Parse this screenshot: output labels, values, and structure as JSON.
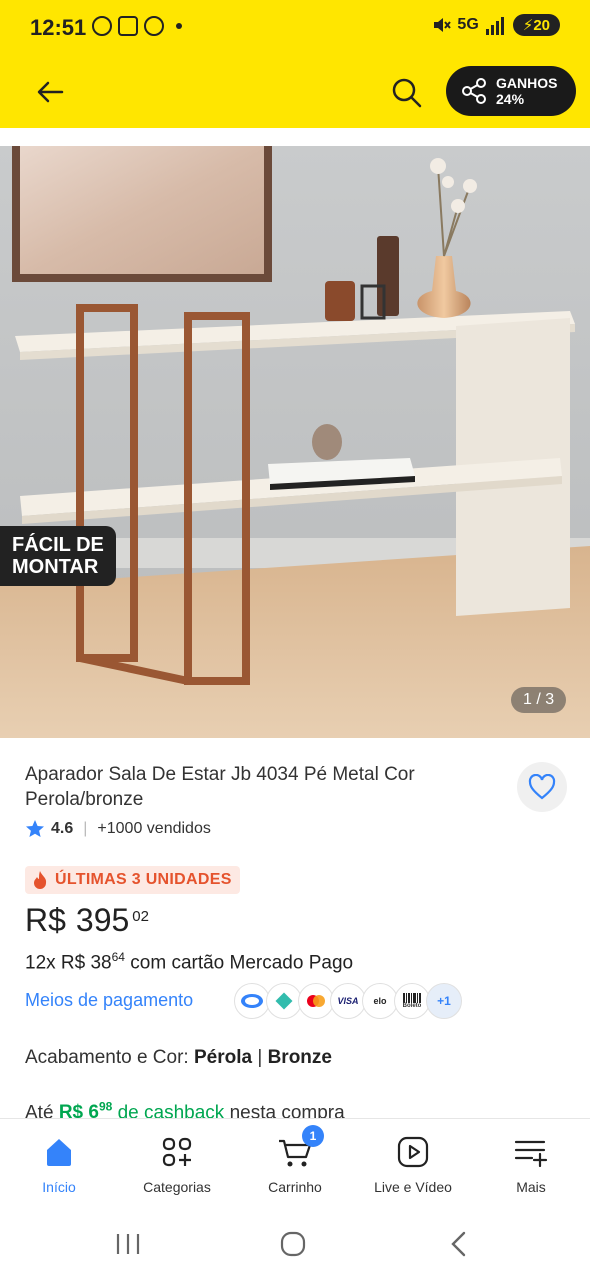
{
  "status_bar": {
    "time": "12:51",
    "battery": "20",
    "network": "5G"
  },
  "header": {
    "ganhos_label": "GANHOS",
    "ganhos_value": "24%"
  },
  "hero": {
    "badge_line1": "FÁCIL DE",
    "badge_line2": "MONTAR",
    "counter": "1 / 3"
  },
  "product": {
    "title": "Aparador Sala De Estar Jb 4034 Pé Metal Cor Perola/bronze",
    "rating": "4.6",
    "sold": "+1000 vendidos",
    "stock_label": "ÚLTIMAS 3 UNIDADES",
    "price_currency": "R$",
    "price_main": "395",
    "price_cents": "02",
    "installments_prefix": "12x R$ 38",
    "installments_cents": "64",
    "installments_suffix": "com cartão Mercado Pago",
    "payment_link": "Meios de pagamento",
    "payment_more": "+1",
    "finish_label": "Acabamento e Cor:",
    "finish_value1": "Pérola",
    "finish_sep": "|",
    "finish_value2": "Bronze",
    "cashback_prefix": "Até",
    "cashback_value": "R$ 6",
    "cashback_cents": "98",
    "cashback_mid": "de cashback",
    "cashback_suffix": "nesta compra"
  },
  "payment_icons": [
    "mercado-pago",
    "pix",
    "mastercard",
    "visa",
    "elo",
    "boleto"
  ],
  "payment_texts": {
    "visa": "VISA",
    "elo": "elo",
    "boleto": "Boleto"
  },
  "bottom_nav": {
    "items": [
      {
        "label": "Início",
        "icon": "home-icon",
        "active": true
      },
      {
        "label": "Categorias",
        "icon": "categories-icon"
      },
      {
        "label": "Carrinho",
        "icon": "cart-icon",
        "badge": "1"
      },
      {
        "label": "Live e Vídeo",
        "icon": "video-icon"
      },
      {
        "label": "Mais",
        "icon": "more-icon"
      }
    ]
  },
  "colors": {
    "brand_yellow": "#ffe600",
    "accent_blue": "#3483fa",
    "stock_red": "#e5532d",
    "cashback_green": "#00a650"
  }
}
